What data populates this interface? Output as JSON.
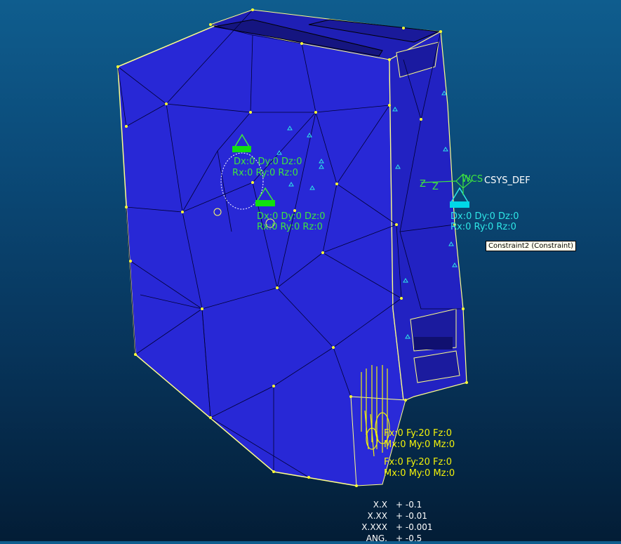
{
  "model_view": {
    "csys_label": "WCS",
    "csys_name": "CSYS_DEF",
    "axis_label": "Z",
    "constraints": [
      {
        "line1": "Dx:0 Dy:0 Dz:0",
        "line2": "Rx:0 Ry:0 Rz:0"
      },
      {
        "line1": "Dx:0 Dy:0 Dz:0",
        "line2": "Rx:0 Ry:0 Rz:0"
      },
      {
        "line1": "Dx:0 Dy:0 Dz:0",
        "line2": "Rx:0 Ry:0 Rz:0"
      }
    ],
    "loads": [
      {
        "line1": "Fx:0 Fy:20 Fz:0",
        "line2": "Mx:0 My:0 Mz:0"
      },
      {
        "line1": "Fx:0 Fy:20 Fz:0",
        "line2": "Mx:0 My:0 Mz:0"
      }
    ],
    "tooltip": "Constraint2 (Constraint)"
  },
  "tolerances": [
    {
      "key": "X.X",
      "value": "+ -0.1"
    },
    {
      "key": "X.XX",
      "value": "+ -0.01"
    },
    {
      "key": "X.XXX",
      "value": "+ -0.001"
    },
    {
      "key": "ANG.",
      "value": "+ -0.5"
    }
  ],
  "colors": {
    "mesh_fill": "#2a2ad4",
    "mesh_edge": "#000033",
    "outline": "#ffff66",
    "constraint": "#3ee63e",
    "constraint_selected": "#2ee6e6",
    "load": "#f2f20a"
  }
}
